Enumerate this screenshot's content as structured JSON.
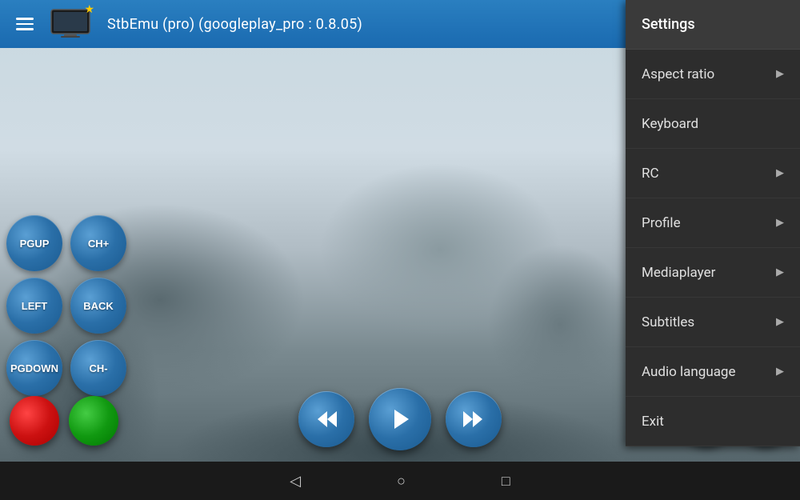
{
  "topbar": {
    "title": "StbEmu (pro) (googleplay_pro : 0.8.05)"
  },
  "menu": {
    "items": [
      {
        "id": "settings",
        "label": "Settings",
        "has_arrow": false
      },
      {
        "id": "aspect-ratio",
        "label": "Aspect ratio",
        "has_arrow": true
      },
      {
        "id": "keyboard",
        "label": "Keyboard",
        "has_arrow": false
      },
      {
        "id": "rc",
        "label": "RC",
        "has_arrow": true
      },
      {
        "id": "profile",
        "label": "Profile",
        "has_arrow": true
      },
      {
        "id": "mediaplayer",
        "label": "Mediaplayer",
        "has_arrow": true
      },
      {
        "id": "subtitles",
        "label": "Subtitles",
        "has_arrow": true
      },
      {
        "id": "audio-language",
        "label": "Audio language",
        "has_arrow": true
      },
      {
        "id": "exit",
        "label": "Exit",
        "has_arrow": false
      }
    ]
  },
  "controls": {
    "pgup": "PGUP",
    "chplus": "CH+",
    "left": "LEFT",
    "back": "BACK",
    "pgdown": "PGDOWN",
    "chminus": "CH-"
  },
  "navbar": {
    "back": "◁",
    "home": "○",
    "square": "□"
  },
  "star": "★"
}
